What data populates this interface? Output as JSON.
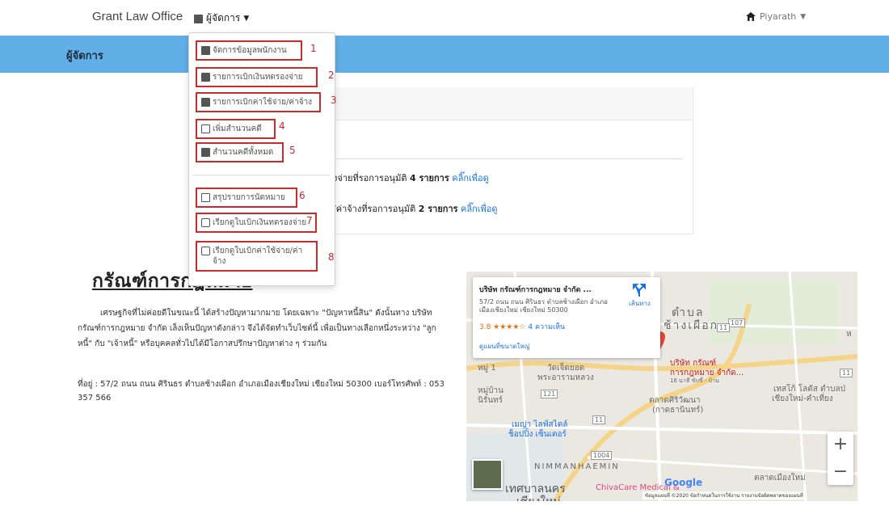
{
  "navbar": {
    "brand": "Grant Law Office",
    "manager_menu": "ผู้จัดการ",
    "user": "Piyarath"
  },
  "banner": {
    "title": "ผู้จัดการ"
  },
  "dropdown": {
    "items": [
      {
        "label": "จัดการข้อมูลพนักงาน",
        "number": "1",
        "icon": "id-card-icon"
      },
      {
        "label": "รายการเบิกเงินทดรองจ่าย",
        "number": "2",
        "icon": "file-icon"
      },
      {
        "label": "รายการเบิกค่าใช้จ่าย/ค่าจ้าง",
        "number": "3",
        "icon": "file-icon"
      },
      {
        "label": "เพิ่มสำนวนคดี",
        "number": "4",
        "icon": "plus-square-icon"
      },
      {
        "label": "สำนวนคดีทั้งหมด",
        "number": "5",
        "icon": "folder-icon"
      },
      {
        "label": "สรุปรายการนัดหมาย",
        "number": "6",
        "icon": "calendar-check-icon"
      },
      {
        "label": "เรียกดูใบเบิกเงินทดรองจ่าย",
        "number": "7",
        "icon": "print-icon"
      },
      {
        "label": "เรียกดูใบเบิกค่าใช้จ่าย/ค่าจ้าง",
        "number": "8",
        "icon": "print-icon"
      }
    ]
  },
  "card": {
    "notice1_text": "งจ่ายที่รอการอนุมัติ",
    "notice1_count": "4 รายการ",
    "notice1_link": "คลิ๊กเพื่อดู",
    "notice2_text": "/ค่าจ้างที่รอการอนุมัติ",
    "notice2_count": "2 รายการ",
    "notice2_link": "คลิ๊กเพื่อดู"
  },
  "article": {
    "heading": "กรัณฑ์การกฎหมาย",
    "paragraph": "เศรษฐกิจที่ไม่ค่อยดีในขณะนี้ ได้สร้างปัญหามากมาย โดยเฉพาะ \"ปัญหาหนี้สิน\" ดังนั้นทาง บริษัท กรัณฑ์การกฎหมาย จำกัด เล็งเห็นปัญหาดังกล่าว จึงได้จัดทำเว็บไซต์นี้ เพื่อเป็นทางเลือกหนึ่งระหว่าง \"ลูกหนี้\" กับ \"เจ้าหนี้\" หรือบุคคลทั่วไปได้มีโอกาสปรึกษาปัญหาต่าง ๆ ร่วมกัน",
    "address": "ที่อยู่ : 57/2 ถนน ถนน ศิรินธร ตำบลช้างเผือก อำเภอเมืองเชียงใหม่ เชียงใหม่ 50300 เบอร์โทรศัพท์ : 053 357 566"
  },
  "map": {
    "place_title": "บริษัท กรัณฑ์การกฎหมาย จำกัด ...",
    "place_address": "57/2 ถนน ถนน ศิรินธร ตำบลช้างเผือก อำเภอเมืองเชียงใหม่ เชียงใหม่ 50300",
    "rating": "3.8 ★★★★☆",
    "reviews": "4 ความเห็น",
    "larger_map": "ดูแผนที่ขนาดใหญ่",
    "directions": "เส้นทาง",
    "zoom_in": "+",
    "zoom_out": "−",
    "labels": {
      "tambon": "ตำบล",
      "chang_phueak": "ช้างเผือก",
      "moo1": "หมู่ 1",
      "wat": "วัดเจ็ดยอด",
      "phra_aram": "พระอารามหลวง",
      "moo_ban": "หมู่บ้าน",
      "nirun": "นิรันทร์",
      "company_pin": "บริษัท กรัณฑ์",
      "company_pin2": "การกฎหมาย จำกัด...",
      "company_pin3": "16 นาที ขับขี่ - บ้าน",
      "market": "ตลาดศิริวัฒนา",
      "market2": "(กาดธานินทร์)",
      "maya": "เมญ่า ไลฟ์สไตล์",
      "maya2": "ช็อปปิ้ง เซ็นเตอร์",
      "nimman": "NIMMANHAEMIN",
      "thesaban": "เทศบาลนคร",
      "chiangmai": "เชียงใหม่",
      "tesco": "เทสโก้ โลตัส ตำบลป่",
      "tesco2": "เชียงใหม่-คำเที่ยง",
      "muang_market": "ตลาดเมืองใหม่",
      "chiva": "ChivaCare Medical &",
      "road_107": "107",
      "road_121": "121",
      "road_1004": "1004",
      "road_11": "11",
      "road_11b": "11",
      "road_11c": "11",
      "ha": "ห"
    },
    "google": "Google",
    "footer": "ข้อมูลแผนที่ ©2020   ข้อกำหนดในการใช้งาน   รายงานข้อผิดพลาดของแผนที่"
  }
}
